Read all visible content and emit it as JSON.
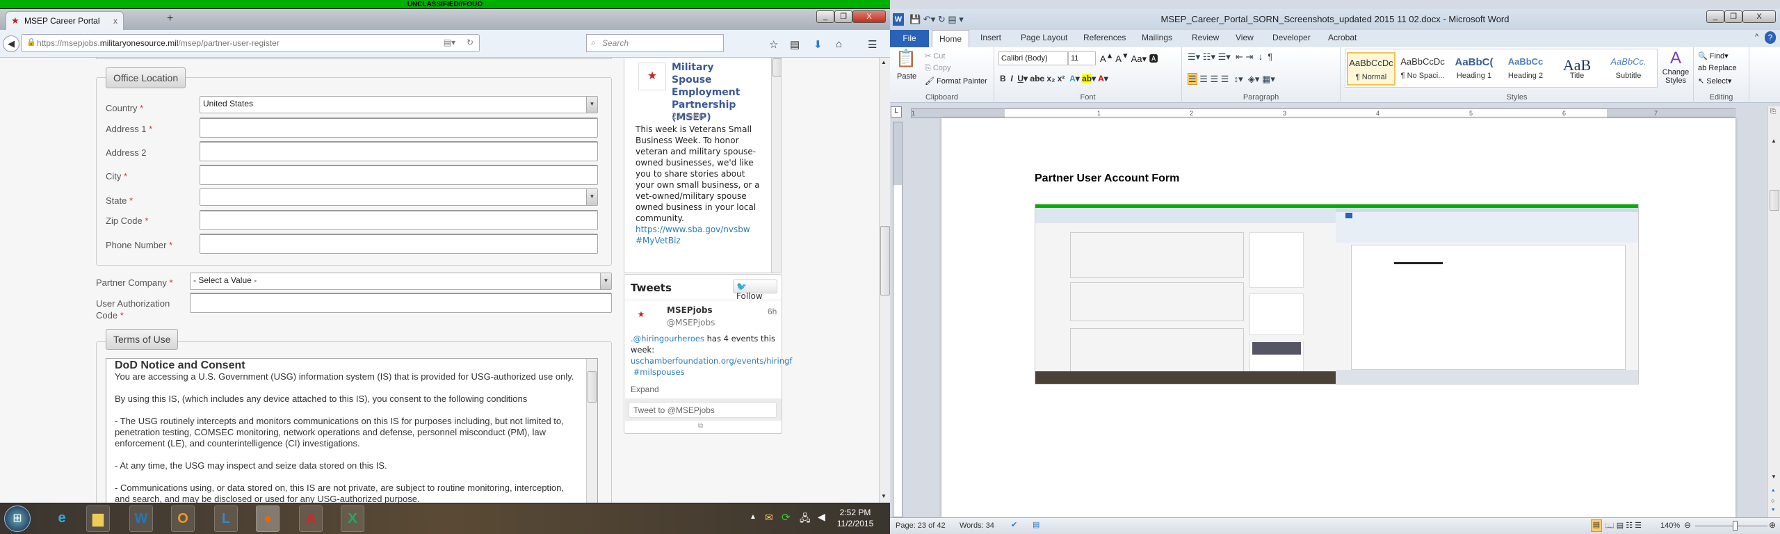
{
  "classification_banner": "UNCLASSIFIED//FOUO",
  "browser": {
    "tab_title": "MSEP Career Portal",
    "tab_close": "x",
    "new_tab": "+",
    "url_prefix": "https://msepjobs.",
    "url_domain": "militaryonesource.mil",
    "url_path": "/msep/partner-user-register",
    "search_placeholder": "Search",
    "window_buttons": [
      "_",
      "❐",
      "X"
    ]
  },
  "form": {
    "office_location_legend": "Office Location",
    "fields": [
      {
        "label": "Country",
        "required": true,
        "type": "select",
        "value": "United States"
      },
      {
        "label": "Address 1",
        "required": true,
        "type": "text",
        "value": ""
      },
      {
        "label": "Address 2",
        "required": false,
        "type": "text",
        "value": ""
      },
      {
        "label": "City",
        "required": true,
        "type": "text",
        "value": ""
      },
      {
        "label": "State",
        "required": true,
        "type": "select",
        "value": ""
      },
      {
        "label": "Zip Code",
        "required": true,
        "type": "text",
        "value": ""
      },
      {
        "label": "Phone Number",
        "required": true,
        "type": "text",
        "value": ""
      }
    ],
    "partner_company_label": "Partner Company",
    "partner_company_value": "- Select a Value -",
    "auth_code_label": "User Authorization Code",
    "required_mark": "*",
    "terms_legend": "Terms of Use",
    "terms_title": "DoD Notice and Consent",
    "terms_paragraphs": [
      "You are accessing a U.S. Government (USG) information system (IS) that is provided for USG-authorized use only.",
      "By using this IS, (which includes any device attached to this IS), you consent to the following conditions",
      "- The USG routinely intercepts and monitors communications on this IS for purposes including, but not limited to, penetration testing, COMSEC monitoring, network operations and defense, personnel misconduct (PM), law enforcement (LE), and counterintelligence (CI) investigations.",
      "- At any time, the USG may inspect and seize data stored on this IS.",
      "- Communications using, or data stored on, this IS are not private, are subject to routine monitoring, interception, and search, and may be disclosed or used for any USG-authorized purpose."
    ]
  },
  "facebook_post": {
    "page_name": "Military Spouse Employment Partnership (MSEP)",
    "time": "21 mins",
    "body": "This week is Veterans Small Business Week. To honor veteran and military spouse-owned businesses, we'd like you to share stories about your own small business, or a vet-owned/military spouse owned business in your local community.",
    "link": "https://www.sba.gov/nvsbw",
    "hashtag": "#MyVetBiz"
  },
  "twitter": {
    "title": "Tweets",
    "follow": "Follow",
    "name": "MSEPjobs",
    "handle": "@MSEPjobs",
    "age": "6h",
    "mention": ".@hiringourheroes",
    "text": " has 4 events this week:",
    "link": "uschamberfoundation.org/events/hiringf",
    "hashtag": "#milspouses",
    "expand": "Expand",
    "compose_placeholder": "Tweet to @MSEPjobs"
  },
  "taskbar": {
    "apps": [
      "start",
      "internet-explorer",
      "file-explorer",
      "word",
      "outlook",
      "lync",
      "firefox",
      "acrobat",
      "excel"
    ],
    "time": "2:52 PM",
    "date": "11/2/2015"
  },
  "word": {
    "title": "MSEP_Career_Portal_SORN_Screenshots_updated 2015 11 02.docx - Microsoft Word",
    "tabs": [
      "File",
      "Home",
      "Insert",
      "Page Layout",
      "References",
      "Mailings",
      "Review",
      "View",
      "Developer",
      "Acrobat"
    ],
    "active_tab": "Home",
    "clipboard": {
      "paste": "Paste",
      "cut": "Cut",
      "copy": "Copy",
      "format_painter": "Format Painter",
      "group": "Clipboard"
    },
    "font": {
      "name": "Calibri (Body)",
      "size": "11",
      "group": "Font"
    },
    "paragraph_group": "Paragraph",
    "styles": [
      {
        "preview": "AaBbCcDc",
        "name": "¶ Normal"
      },
      {
        "preview": "AaBbCcDc",
        "name": "¶ No Spaci..."
      },
      {
        "preview": "AaBbC(",
        "name": "Heading 1"
      },
      {
        "preview": "AaBbCc",
        "name": "Heading 2"
      },
      {
        "preview": "AaB",
        "name": "Title"
      },
      {
        "preview": "AaBbCc.",
        "name": "Subtitle"
      }
    ],
    "styles_group": "Styles",
    "change_styles": "Change Styles",
    "editing": {
      "find": "Find",
      "replace": "Replace",
      "select": "Select",
      "group": "Editing"
    },
    "ruler_numbers": [
      "1",
      "1",
      "2",
      "3",
      "4",
      "5",
      "6",
      "7"
    ],
    "doc_heading": "Partner User Account Form",
    "status": {
      "page": "Page: 23 of 42",
      "words": "Words: 34",
      "zoom": "140%"
    },
    "zoom_level_percent": 140
  }
}
